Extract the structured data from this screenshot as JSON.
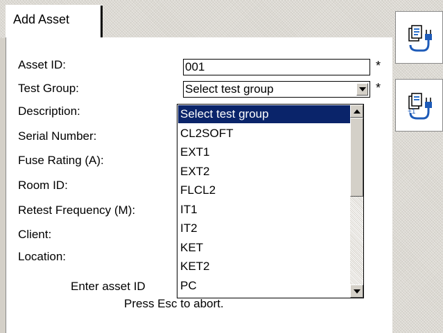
{
  "tab": {
    "label": "Add Asset"
  },
  "fields": {
    "asset_id": {
      "label": "Asset ID:",
      "value": "001",
      "required": "*"
    },
    "test_group": {
      "label": "Test Group:",
      "value": "Select test group",
      "required": "*"
    },
    "description": {
      "label": "Description:"
    },
    "serial_number": {
      "label": "Serial Number:"
    },
    "fuse_rating": {
      "label": "Fuse Rating (A):"
    },
    "room_id": {
      "label": "Room ID:"
    },
    "retest_frequency": {
      "label": "Retest Frequency (M):"
    },
    "client": {
      "label": "Client:"
    },
    "location": {
      "label": "Location:"
    }
  },
  "dropdown": {
    "options": [
      "Select test group",
      "CL2SOFT",
      "EXT1",
      "EXT2",
      "FLCL2",
      "IT1",
      "IT2",
      "KET",
      "KET2",
      "PC"
    ],
    "selected": "Select test group"
  },
  "help": {
    "line1": "Enter asset ID",
    "line2": "Press Esc to abort."
  },
  "right_buttons": {
    "icons": [
      "clipboard-plug-icon",
      "clipboard-plug-plus-one-icon"
    ],
    "plus_text": "+1"
  },
  "colors": {
    "selection": "#0a246a",
    "background": "#d4d0c8"
  }
}
